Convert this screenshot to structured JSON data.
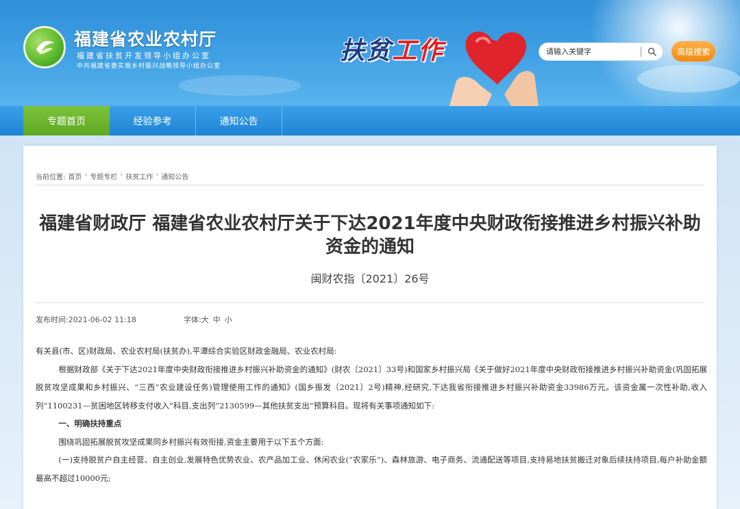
{
  "header": {
    "site_name": "福建省农业农村厅",
    "sub_line1": "福建省扶贫开发领导小组办公室",
    "sub_line2": "中共福建省委实施乡村振兴战略领导小组办公室",
    "banner_title_part1": "扶贫",
    "banner_title_part2": "工作",
    "search_placeholder": "请输入关键字",
    "advanced_search_label": "高级搜索"
  },
  "nav": {
    "items": [
      {
        "label": "专题首页"
      },
      {
        "label": "经验参考"
      },
      {
        "label": "通知公告"
      }
    ]
  },
  "breadcrumb": {
    "prefix": "当前位置:",
    "items": [
      "首页",
      "专题专栏",
      "扶贫工作",
      "通知公告"
    ],
    "separator": "›"
  },
  "article": {
    "title": "福建省财政厅 福建省农业农村厅关于下达2021年度中央财政衔接推进乡村振兴补助资金的通知",
    "doc_number": "闽财农指〔2021〕26号",
    "publish_label": "发布时间:2021-06-02 11:18",
    "font_label": "字体:",
    "font_sizes": [
      "大",
      "中",
      "小"
    ],
    "paragraphs": [
      "有关县(市、区)财政局、农业农村局(扶贫办),平潭综合实验区财政金融局、农业农村局:",
      "根据财政部《关于下达2021年度中央财政衔接推进乡村振兴补助资金的通知》(财农〔2021〕33号)和国家乡村振兴局《关于做好2021年度中央财政衔接推进乡村振兴补助资金(巩固拓展脱贫攻坚成果和乡村振兴、“三西”农业建设任务)管理使用工作的通知》(国乡振发〔2021〕2号)精神,经研究,下达我省衔接推进乡村振兴补助资金33986万元。该资金属一次性补助,收入列“1100231—贫困地区转移支付收入”科目,支出列“2130599—其他扶贫支出”预算科目。现将有关事项通知如下:",
      "一、明确扶持重点",
      "围绕巩固拓展脱贫攻坚成果同乡村振兴有效衔接,资金主要用于以下五个方面:",
      "(一)支持脱贫户自主经营、自主创业,发展特色优势农业、农产品加工业、休闲农业(“农家乐”)、森林旅游、电子商务、流通配送等项目,支持易地扶贫搬迁对象后续扶持项目,每户补助金额最高不超过10000元;"
    ]
  },
  "colors": {
    "header_blue": "#2f8fd8",
    "nav_blue": "#1f86d6",
    "nav_active_green": "#5da822",
    "advanced_orange": "#f08a12"
  }
}
